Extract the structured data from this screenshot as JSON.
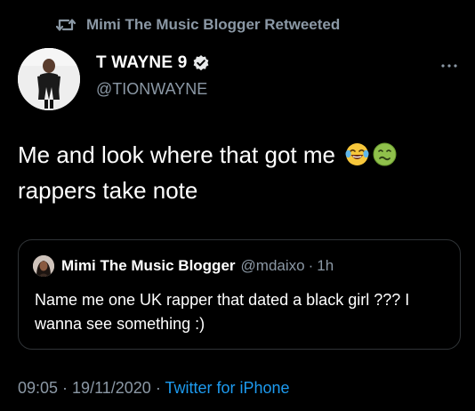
{
  "retweet": {
    "icon": "retweet-icon",
    "label": "Mimi The Music Blogger Retweeted"
  },
  "author": {
    "display_name": "T WAYNE 9",
    "handle": "@TIONWAYNE",
    "verified_icon": "verified-badge-icon",
    "more_icon": "more-options-icon"
  },
  "tweet": {
    "line1": "Me and look where that got me",
    "line2": "rappers take note",
    "emojis": [
      "face-with-tears-of-joy-emoji",
      "nauseated-face-emoji"
    ]
  },
  "quoted_tweet": {
    "display_name": "Mimi The Music Blogger",
    "handle": "@mdaixo",
    "separator": "·",
    "time": "1h",
    "text": "Name me one UK rapper that dated a black girl ??? I wanna see something :)"
  },
  "meta": {
    "time": "09:05",
    "separator1": " · ",
    "date": "19/11/2020",
    "separator2": " · ",
    "source": "Twitter for iPhone"
  },
  "colors": {
    "background": "#000000",
    "text": "#ffffff",
    "secondary": "#8b98a5",
    "link": "#1d9bf0",
    "border": "#2f3336"
  }
}
